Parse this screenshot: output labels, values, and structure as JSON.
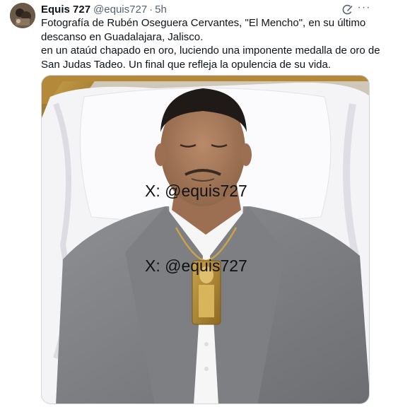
{
  "tweet": {
    "author_name": "Equis 727",
    "handle": "@equis727",
    "separator": "·",
    "time": "5h",
    "more_label": "···",
    "text_lines": [
      "Fotografía de Rubén Oseguera Cervantes, \"El Mencho\", en su último",
      "descanso en Guadalajara, Jalisco.",
      "en un ataúd chapado en oro, luciendo una imponente medalla de oro de",
      "San Judas Tadeo. Un final que refleja la opulencia de su vida."
    ]
  },
  "media": {
    "watermark_1": "X:  @equis727",
    "watermark_2": "X:  @equis727"
  },
  "icons": {
    "avatar": "avatar",
    "grok": "grok-icon",
    "more": "more-icon"
  },
  "colors": {
    "text_primary": "#0f1419",
    "text_secondary": "#536471",
    "border": "#cfd9de"
  }
}
